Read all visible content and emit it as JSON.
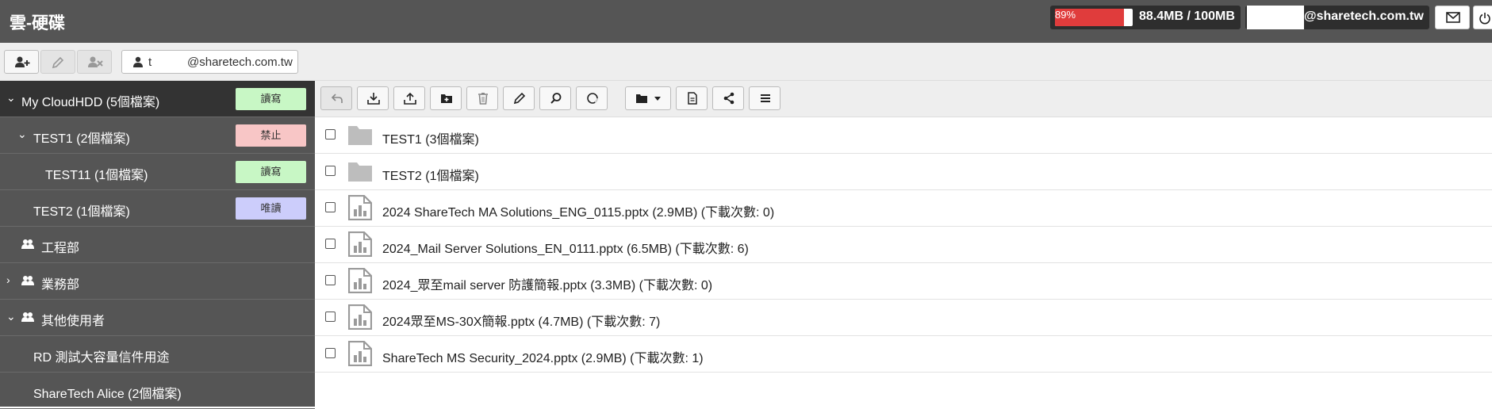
{
  "app": {
    "title": "雲-硬碟"
  },
  "quota": {
    "percent_label": "89%",
    "fraction": 0.89,
    "usage": "88.4MB / 100MB"
  },
  "account": {
    "email_suffix": "@sharetech.com.tw"
  },
  "subbar": {
    "user_prefix": "t",
    "user_suffix": "@sharetech.com.tw"
  },
  "sidebar": {
    "items": [
      {
        "label": "My CloudHDD (5個檔案)",
        "chevron": "⌄",
        "permission": "讀寫",
        "perm_type": "rw"
      },
      {
        "label": "TEST1 (2個檔案)",
        "chevron": "⌄",
        "permission": "禁止",
        "perm_type": "no"
      },
      {
        "label": "TEST11 (1個檔案)",
        "chevron": "",
        "permission": "讀寫",
        "perm_type": "rw"
      },
      {
        "label": "TEST2 (1個檔案)",
        "chevron": "",
        "permission": "唯讀",
        "perm_type": "ro"
      },
      {
        "label": "工程部",
        "chevron": "",
        "icon": "group-icon"
      },
      {
        "label": "業務部",
        "chevron": "›",
        "icon": "group-icon"
      },
      {
        "label": "其他使用者",
        "chevron": "⌄",
        "icon": "group-icon"
      },
      {
        "label": "RD 測試大容量信件用途",
        "chevron": ""
      },
      {
        "label": "ShareTech Alice (2個檔案)",
        "chevron": ""
      }
    ]
  },
  "files": [
    {
      "name": "TEST1 (3個檔案)",
      "type": "folder"
    },
    {
      "name": "TEST2 (1個檔案)",
      "type": "folder"
    },
    {
      "name": "2024 ShareTech MA Solutions_ENG_0115.pptx (2.9MB) (下載次數: 0)",
      "type": "file"
    },
    {
      "name": "2024_Mail Server Solutions_EN_0111.pptx (6.5MB) (下載次數: 6)",
      "type": "file"
    },
    {
      "name": "2024_眾至mail server 防護簡報.pptx (3.3MB) (下載次數: 0)",
      "type": "file"
    },
    {
      "name": "2024眾至MS-30X簡報.pptx (4.7MB) (下載次數: 7)",
      "type": "file"
    },
    {
      "name": "ShareTech MS Security_2024.pptx (2.9MB) (下載次數: 1)",
      "type": "file"
    }
  ]
}
